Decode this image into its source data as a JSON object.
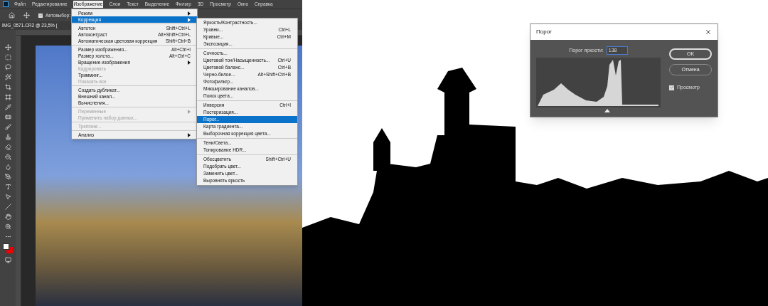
{
  "menubar": [
    {
      "label": "Файл",
      "selected": false
    },
    {
      "label": "Редактирование",
      "selected": false
    },
    {
      "label": "Изображение",
      "selected": true
    },
    {
      "label": "Слои",
      "selected": false
    },
    {
      "label": "Текст",
      "selected": false
    },
    {
      "label": "Выделение",
      "selected": false
    },
    {
      "label": "Фильтр",
      "selected": false
    },
    {
      "label": "3D",
      "selected": false
    },
    {
      "label": "Просмотр",
      "selected": false
    },
    {
      "label": "Окно",
      "selected": false
    },
    {
      "label": "Справка",
      "selected": false
    }
  ],
  "options_bar": {
    "autoselect": {
      "label": "Автовыбор:",
      "checked": true
    }
  },
  "document_tab": {
    "title": "IMG_0571.CR2 @ 23,5% ("
  },
  "image_menu": {
    "groups": [
      {
        "items": [
          {
            "label": "Режим",
            "submenu": true,
            "disabled": false,
            "selected": false
          },
          {
            "label": "Коррекция",
            "submenu": true,
            "disabled": false,
            "selected": true
          }
        ]
      },
      {
        "items": [
          {
            "label": "Автотон",
            "shortcut": "Shift+Ctrl+L",
            "submenu": false,
            "disabled": false,
            "selected": false
          },
          {
            "label": "Автоконтраст",
            "shortcut": "Alt+Shift+Ctrl+L",
            "submenu": false,
            "disabled": false,
            "selected": false
          },
          {
            "label": "Автоматическая цветовая коррекция",
            "shortcut": "Shift+Ctrl+B",
            "submenu": false,
            "disabled": false,
            "selected": false
          }
        ]
      },
      {
        "items": [
          {
            "label": "Размер изображения...",
            "shortcut": "Alt+Ctrl+I",
            "submenu": false,
            "disabled": false,
            "selected": false
          },
          {
            "label": "Размер холста...",
            "shortcut": "Alt+Ctrl+C",
            "submenu": false,
            "disabled": false,
            "selected": false
          },
          {
            "label": "Вращение изображения",
            "submenu": true,
            "disabled": false,
            "selected": false
          },
          {
            "label": "Кадрировать",
            "submenu": false,
            "disabled": true,
            "selected": false
          },
          {
            "label": "Тримминг...",
            "submenu": false,
            "disabled": false,
            "selected": false
          },
          {
            "label": "Показать все",
            "submenu": false,
            "disabled": true,
            "selected": false
          }
        ]
      },
      {
        "items": [
          {
            "label": "Создать дубликат...",
            "submenu": false,
            "disabled": false,
            "selected": false
          },
          {
            "label": "Внешний канал...",
            "submenu": false,
            "disabled": false,
            "selected": false
          },
          {
            "label": "Вычисления...",
            "submenu": false,
            "disabled": false,
            "selected": false
          }
        ]
      },
      {
        "items": [
          {
            "label": "Переменные",
            "submenu": true,
            "disabled": true,
            "selected": false
          },
          {
            "label": "Применить набор данных...",
            "submenu": false,
            "disabled": true,
            "selected": false
          }
        ]
      },
      {
        "items": [
          {
            "label": "Треппинг...",
            "submenu": false,
            "disabled": true,
            "selected": false
          }
        ]
      },
      {
        "items": [
          {
            "label": "Анализ",
            "submenu": true,
            "disabled": false,
            "selected": false
          }
        ]
      }
    ]
  },
  "correction_menu": {
    "groups": [
      {
        "items": [
          {
            "label": "Яркость/Контрастность...",
            "selected": false
          },
          {
            "label": "Уровни...",
            "shortcut": "Ctrl+L",
            "selected": false
          },
          {
            "label": "Кривые...",
            "shortcut": "Ctrl+M",
            "selected": false
          },
          {
            "label": "Экспозиция...",
            "selected": false
          }
        ]
      },
      {
        "items": [
          {
            "label": "Сочность...",
            "selected": false
          },
          {
            "label": "Цветовой тон/Насыщенность...",
            "shortcut": "Ctrl+U",
            "selected": false
          },
          {
            "label": "Цветовой баланс...",
            "shortcut": "Ctrl+B",
            "selected": false
          },
          {
            "label": "Черно-белое...",
            "shortcut": "Alt+Shift+Ctrl+B",
            "selected": false
          },
          {
            "label": "Фотофильтр...",
            "selected": false
          },
          {
            "label": "Микширование каналов...",
            "selected": false
          },
          {
            "label": "Поиск цвета...",
            "selected": false
          }
        ]
      },
      {
        "items": [
          {
            "label": "Инверсия",
            "shortcut": "Ctrl+I",
            "selected": false
          },
          {
            "label": "Постеризация...",
            "selected": false
          },
          {
            "label": "Порог...",
            "selected": true
          },
          {
            "label": "Карта градиента...",
            "selected": false
          },
          {
            "label": "Выборочная коррекция цвета...",
            "selected": false
          }
        ]
      },
      {
        "items": [
          {
            "label": "Тени/Света...",
            "selected": false
          },
          {
            "label": "Тонирование HDR...",
            "selected": false
          }
        ]
      },
      {
        "items": [
          {
            "label": "Обесцветить",
            "shortcut": "Shift+Ctrl+U",
            "selected": false
          },
          {
            "label": "Подобрать цвет...",
            "selected": false
          },
          {
            "label": "Заменить цвет...",
            "selected": false
          },
          {
            "label": "Выровнять яркость",
            "selected": false
          }
        ]
      }
    ]
  },
  "threshold_dialog": {
    "title": "Порог",
    "threshold_label": "Порог яркости:",
    "threshold_value": "138",
    "buttons": [
      {
        "label": "OK",
        "primary": true
      },
      {
        "label": "Отмена",
        "primary": false
      }
    ],
    "preview": {
      "label": "Просмотр",
      "checked": true
    }
  }
}
